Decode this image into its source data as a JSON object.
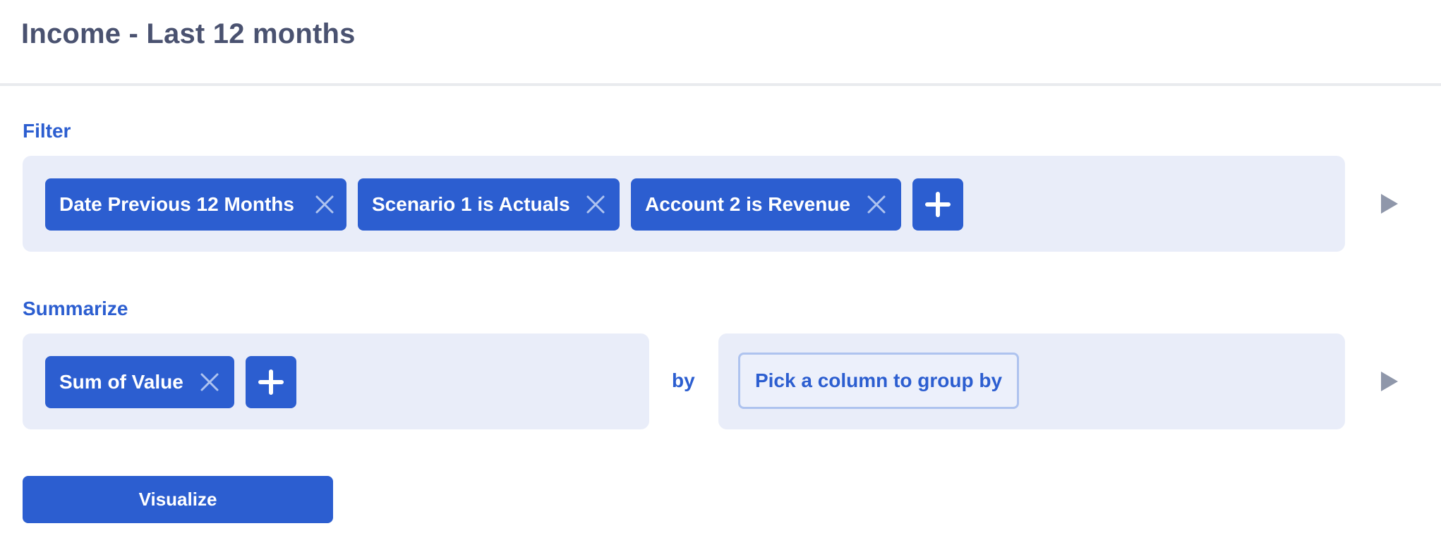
{
  "header": {
    "title": "Income - Last 12 months"
  },
  "filter": {
    "label": "Filter",
    "chips": [
      {
        "label": "Date Previous 12 Months"
      },
      {
        "label": "Scenario 1 is Actuals"
      },
      {
        "label": "Account 2 is Revenue"
      }
    ]
  },
  "summarize": {
    "label": "Summarize",
    "chips": [
      {
        "label": "Sum of Value"
      }
    ],
    "by_label": "by",
    "group_by_placeholder": "Pick a column to group by"
  },
  "actions": {
    "visualize_label": "Visualize"
  },
  "colors": {
    "accent": "#2c5ed0",
    "panel_bg": "#e9edf9",
    "title": "#4a5270",
    "arrow": "#8f97aa"
  },
  "icons": [
    "close-icon",
    "plus-icon",
    "play-arrow-icon"
  ]
}
